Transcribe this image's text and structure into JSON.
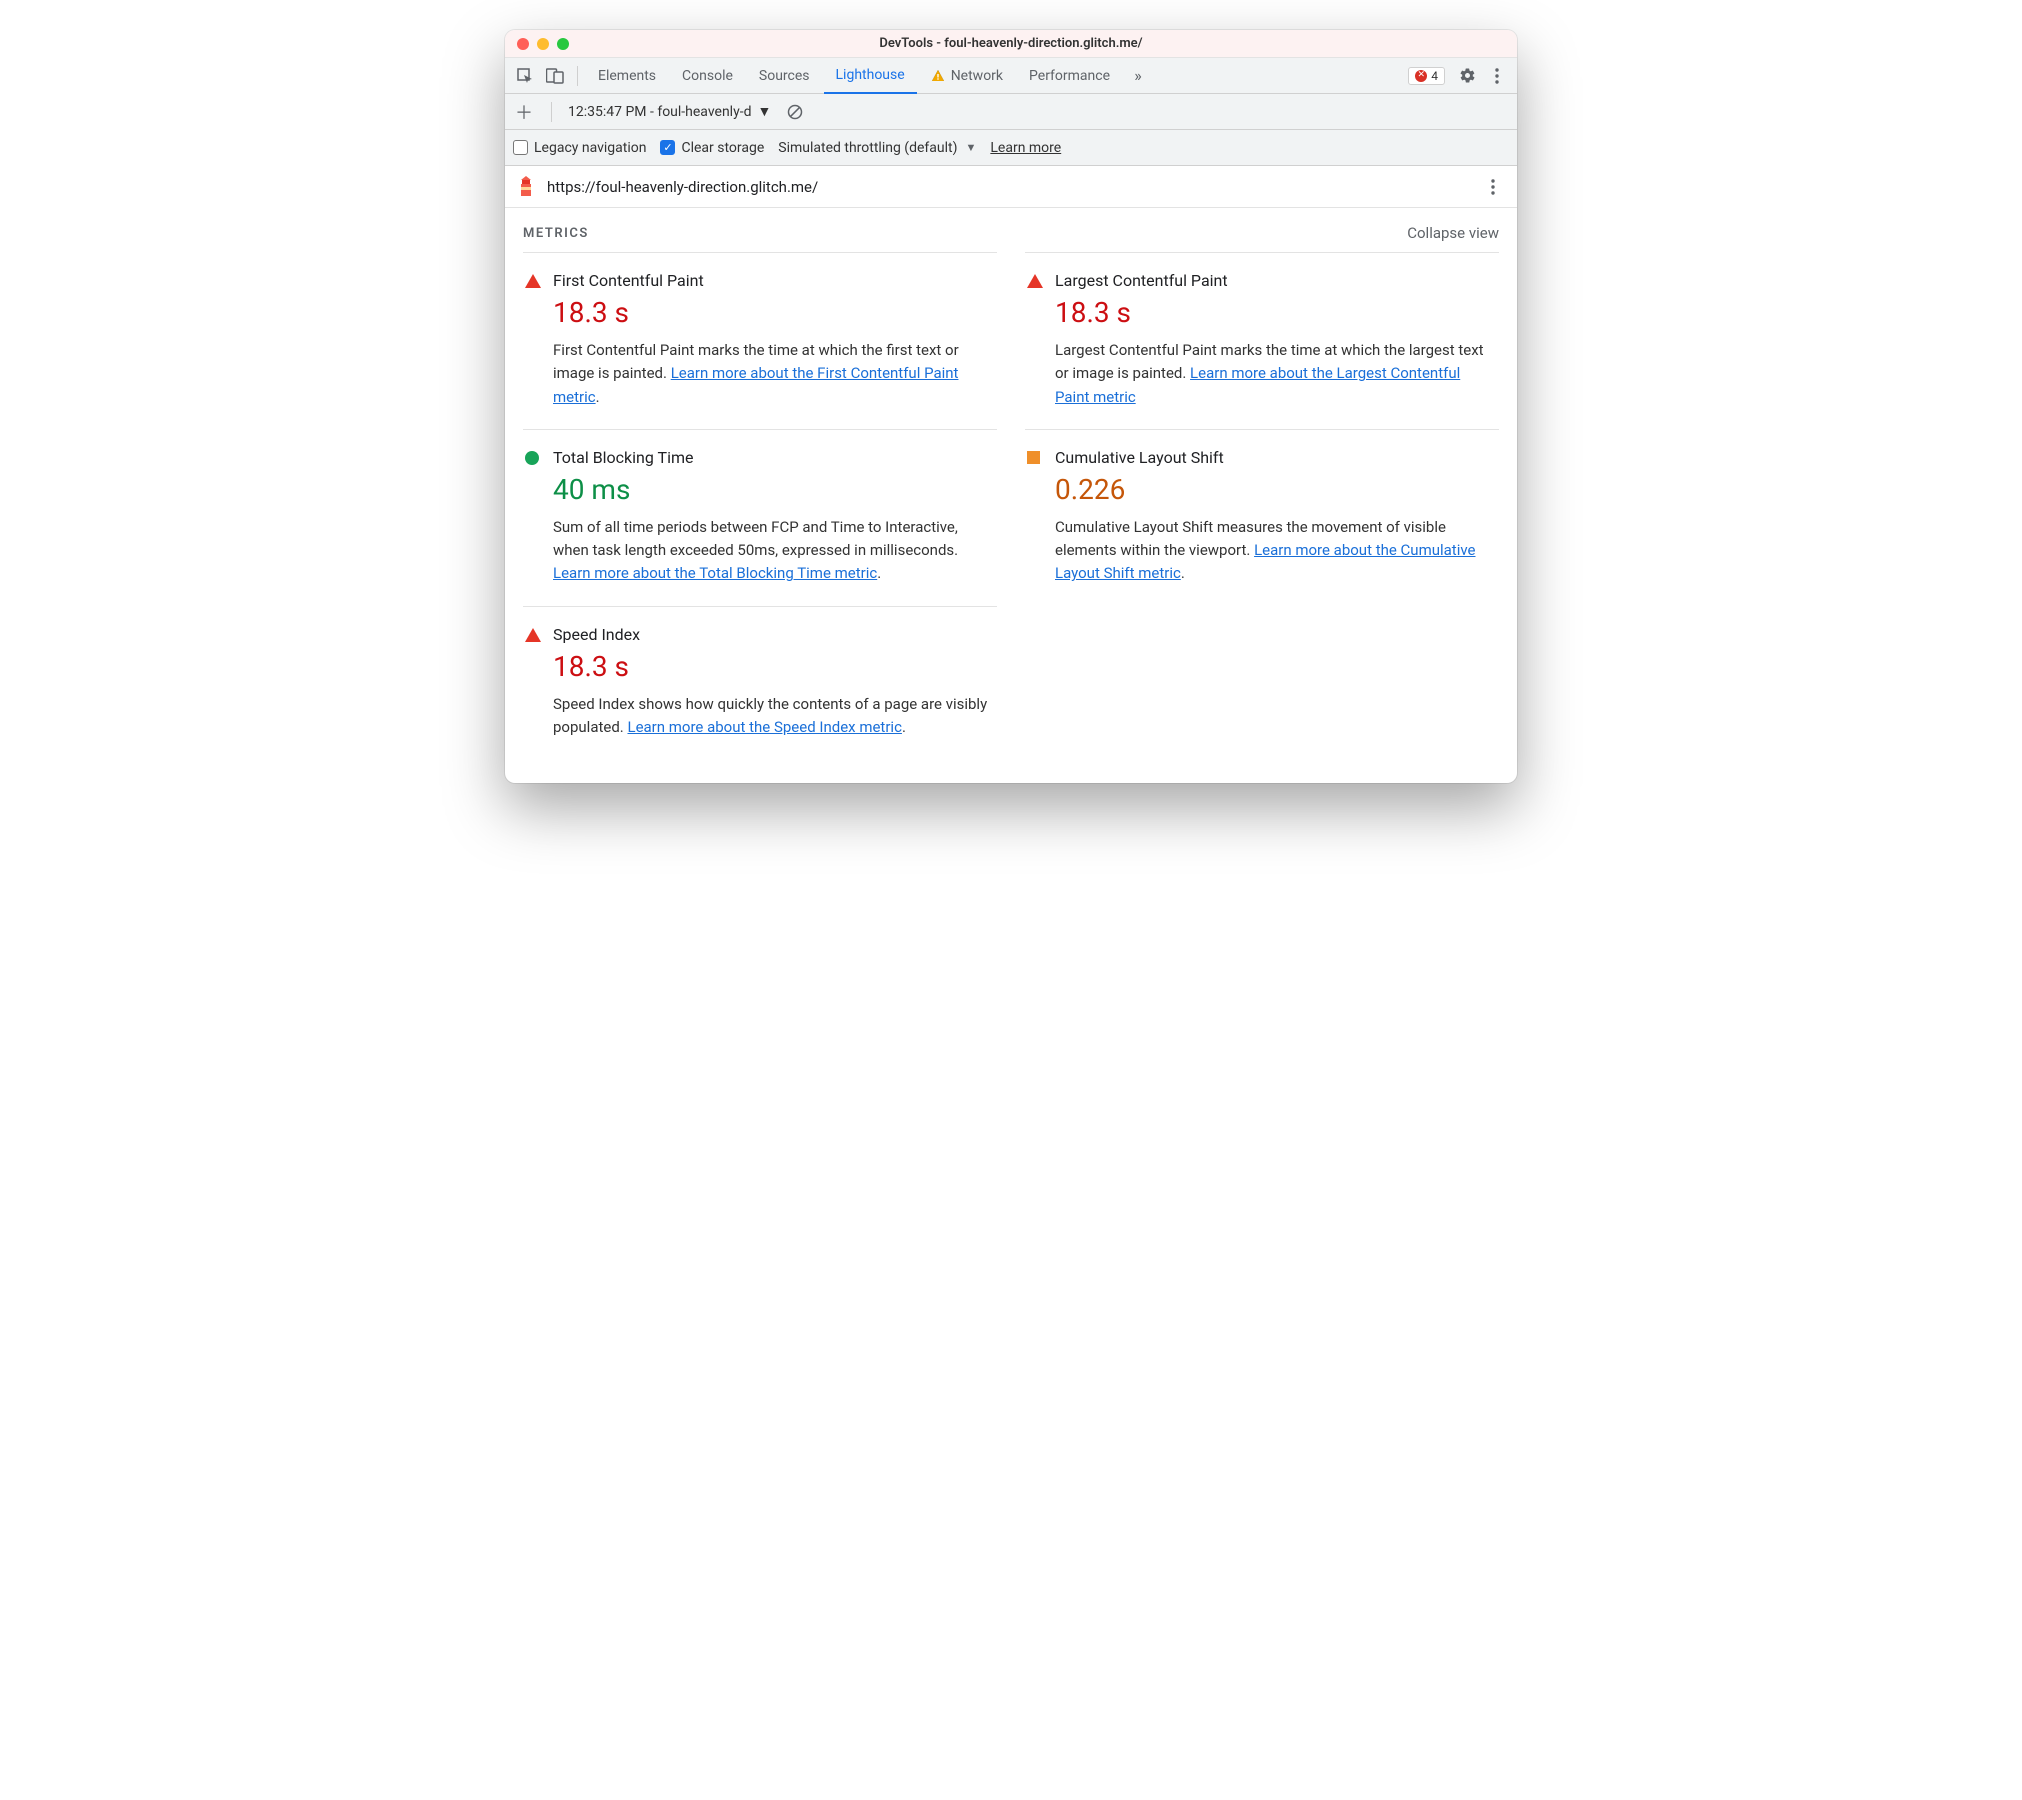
{
  "window": {
    "title": "DevTools - foul-heavenly-direction.glitch.me/"
  },
  "tabs": {
    "items": [
      "Elements",
      "Console",
      "Sources",
      "Lighthouse",
      "Network",
      "Performance"
    ],
    "active": "Lighthouse",
    "errors": "4"
  },
  "row2": {
    "report_label": "12:35:47 PM - foul-heavenly-d"
  },
  "row3": {
    "legacy_label": "Legacy navigation",
    "clear_label": "Clear storage",
    "throttle_label": "Simulated throttling (default)",
    "learn": "Learn more"
  },
  "url": "https://foul-heavenly-direction.glitch.me/",
  "metrics": {
    "title": "METRICS",
    "collapse": "Collapse view",
    "cards": [
      {
        "status": "red",
        "title": "First Contentful Paint",
        "value": "18.3 s",
        "desc": "First Contentful Paint marks the time at which the first text or image is painted. ",
        "link": "Learn more about the First Contentful Paint metric",
        "after": "."
      },
      {
        "status": "red",
        "title": "Largest Contentful Paint",
        "value": "18.3 s",
        "desc": "Largest Contentful Paint marks the time at which the largest text or image is painted. ",
        "link": "Learn more about the Largest Contentful Paint metric",
        "after": ""
      },
      {
        "status": "green",
        "title": "Total Blocking Time",
        "value": "40 ms",
        "desc": "Sum of all time periods between FCP and Time to Interactive, when task length exceeded 50ms, expressed in milliseconds. ",
        "link": "Learn more about the Total Blocking Time metric",
        "after": "."
      },
      {
        "status": "orange",
        "title": "Cumulative Layout Shift",
        "value": "0.226",
        "desc": "Cumulative Layout Shift measures the movement of visible elements within the viewport. ",
        "link": "Learn more about the Cumulative Layout Shift metric",
        "after": "."
      },
      {
        "status": "red",
        "title": "Speed Index",
        "value": "18.3 s",
        "desc": "Speed Index shows how quickly the contents of a page are visibly populated. ",
        "link": "Learn more about the Speed Index metric",
        "after": "."
      }
    ]
  }
}
